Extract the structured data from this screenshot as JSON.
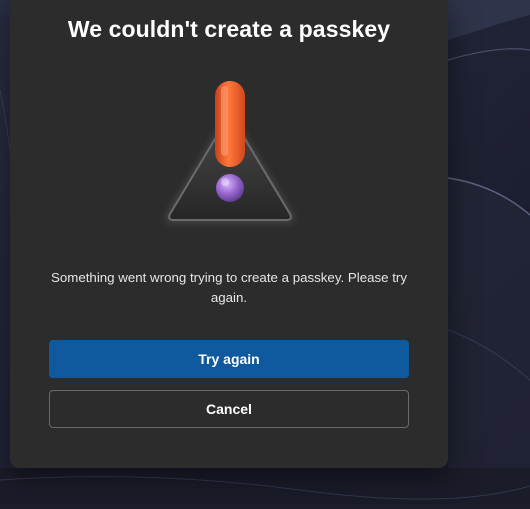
{
  "dialog": {
    "title": "We couldn't create a passkey",
    "message": "Something went wrong trying to create a passkey. Please try again.",
    "icon": "warning-triangle-icon",
    "primary_button": "Try again",
    "secondary_button": "Cancel"
  },
  "colors": {
    "dialog_bg": "#2c2c2c",
    "primary_button": "#0f5a9e",
    "exclamation_bar": "#ef5a24",
    "exclamation_dot": "#9b6ad0"
  }
}
